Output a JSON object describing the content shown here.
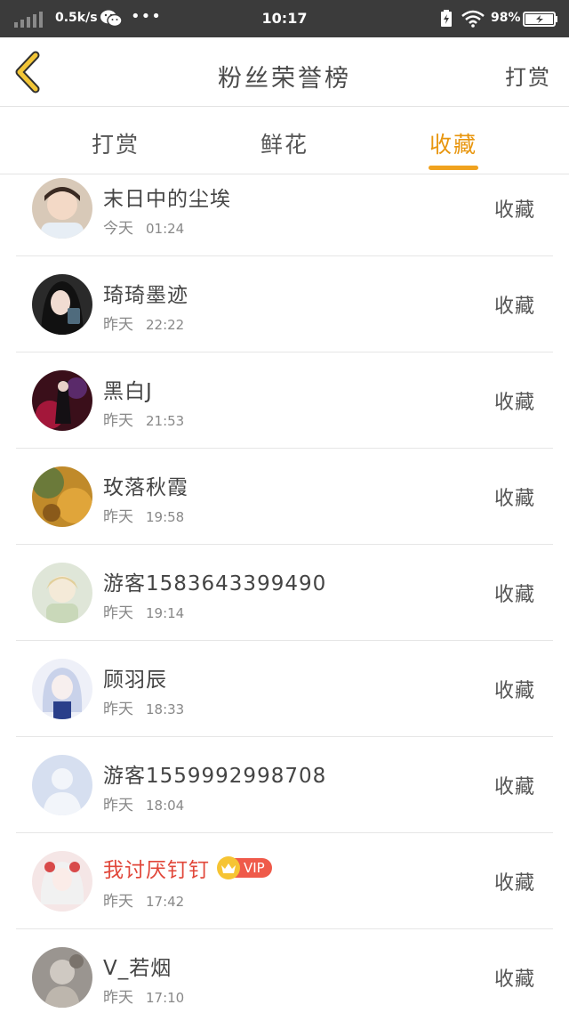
{
  "status_bar": {
    "speed": "0.5k/s",
    "dots": "•••",
    "time": "10:17",
    "battery_pct": "98%"
  },
  "header": {
    "back_icon": "chevron-left-icon",
    "title": "粉丝荣誉榜",
    "action": "打赏"
  },
  "tabs": [
    {
      "label": "打赏",
      "active": false
    },
    {
      "label": "鲜花",
      "active": false
    },
    {
      "label": "收藏",
      "active": true
    }
  ],
  "colors": {
    "accent": "#f0a21e",
    "vip_name": "#e1473a",
    "status_bar": "#3b3b3b"
  },
  "list": [
    {
      "name": "末日中的尘埃",
      "day": "今天",
      "time": "01:24",
      "action": "收藏"
    },
    {
      "name": "琦琦墨迹",
      "day": "昨天",
      "time": "22:22",
      "action": "收藏"
    },
    {
      "name": "黑白J",
      "day": "昨天",
      "time": "21:53",
      "action": "收藏"
    },
    {
      "name": "玫落秋霞",
      "day": "昨天",
      "time": "19:58",
      "action": "收藏"
    },
    {
      "name": "游客1583643399490",
      "day": "昨天",
      "time": "19:14",
      "action": "收藏"
    },
    {
      "name": "顾羽辰",
      "day": "昨天",
      "time": "18:33",
      "action": "收藏"
    },
    {
      "name": "游客1559992998708",
      "day": "昨天",
      "time": "18:04",
      "action": "收藏"
    },
    {
      "name": "我讨厌钉钉",
      "vip": "VIP",
      "day": "昨天",
      "time": "17:42",
      "action": "收藏"
    },
    {
      "name": "V_若烟",
      "day": "昨天",
      "time": "17:10",
      "action": "收藏"
    }
  ]
}
